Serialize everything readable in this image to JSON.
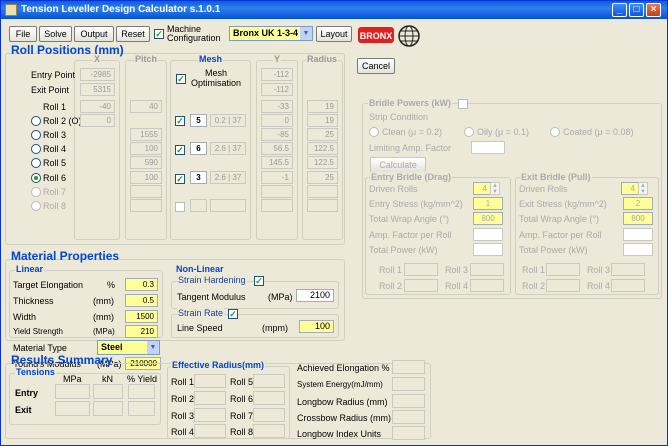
{
  "window": {
    "title": "Tension Leveller Design Calculator s.1.0.1"
  },
  "menu": {
    "file": "File",
    "solve": "Solve",
    "output": "Output",
    "reset": "Reset",
    "machine_config": "Machine Configuration",
    "config_value": "Bronx UK 1-3-4",
    "layout": "Layout",
    "cancel": "Cancel",
    "logo_text": "BRONX"
  },
  "rolls": {
    "title": "Roll Positions (mm)",
    "col_x": "X",
    "col_pitch": "Pitch",
    "col_mesh": "Mesh",
    "col_y": "Y",
    "col_radius": "Radius",
    "entry_point": "Entry Point",
    "exit_point": "Exit Point",
    "entry_x": "-2985",
    "exit_x": "5315",
    "entry_y": "-112",
    "exit_y": "-112",
    "mesh_opt": "Mesh Optimisation",
    "rows": [
      {
        "label": "Roll 1",
        "x": "-40",
        "pitch": "40",
        "mesh": "",
        "ratio": "",
        "y": "-33",
        "r": "19"
      },
      {
        "label": "Roll 2 (O)",
        "x": "0",
        "pitch": "",
        "mesh": "5",
        "ratio": "0.2 | 37",
        "y": "0",
        "r": "19"
      },
      {
        "label": "Roll 3",
        "x": "",
        "pitch": "1555",
        "mesh": "",
        "ratio": "",
        "y": "-85",
        "r": "25"
      },
      {
        "label": "Roll 4",
        "x": "",
        "pitch": "100",
        "mesh": "6",
        "ratio": "2.6 | 37",
        "y": "56.5",
        "r": "122.5"
      },
      {
        "label": "Roll 5",
        "x": "",
        "pitch": "590",
        "mesh": "",
        "ratio": "",
        "y": "145.5",
        "r": "122.5"
      },
      {
        "label": "Roll 6",
        "x": "",
        "pitch": "100",
        "mesh": "3",
        "ratio": "2.6 | 37",
        "y": "-1",
        "r": "25"
      },
      {
        "label": "Roll 7",
        "x": "",
        "pitch": "",
        "mesh": "",
        "ratio": "",
        "y": "",
        "r": ""
      },
      {
        "label": "Roll 8",
        "x": "",
        "pitch": "",
        "mesh": "",
        "ratio": "",
        "y": "",
        "r": ""
      }
    ]
  },
  "bridle": {
    "title": "Bridle Powers (kW)",
    "strip": "Strip Condition",
    "clean": "Clean (μ = 0.2)",
    "oily": "Oily (μ = 0.1)",
    "coated": "Coated (μ = 0.08)",
    "limiting": "Limiting Amp. Factor",
    "calculate": "Calculate",
    "entry_title": "Entry Bridle (Drag)",
    "exit_title": "Exit Bridle (Pull)",
    "driven": "Driven Rolls",
    "entry_stress": "Entry Stress (kg/mm^2)",
    "exit_stress": "Exit Stress (kg/mm^2)",
    "wrap": "Total Wrap Angle  (°)",
    "amp": "Amp. Factor per Roll",
    "power": "Total Power  (kW)",
    "entry_driven": "4",
    "entry_stress_val": "1",
    "entry_wrap": "800",
    "exit_driven": "4",
    "exit_stress_val": "2",
    "exit_wrap": "800",
    "r1": "Roll 1",
    "r2": "Roll 2",
    "r3": "Roll 3",
    "r4": "Roll 4"
  },
  "material": {
    "title": "Material Properties",
    "linear": "Linear",
    "nonlinear": "Non-Linear",
    "elong": "Target Elongation",
    "elong_u": "%",
    "elong_v": "0.3",
    "thick": "Thickness",
    "thick_u": "(mm)",
    "thick_v": "0.5",
    "width": "Width",
    "width_u": "(mm)",
    "width_v": "1500",
    "yield": "Yield Strength",
    "yield_u": "(MPa)",
    "yield_v": "210",
    "mtype": "Material Type",
    "mtype_v": "Steel",
    "young": "Young's Modulus",
    "young_u": "(MPa)",
    "young_v": "210000",
    "hard": "Strain Hardening",
    "tangent": "Tangent Modulus",
    "tangent_u": "(MPa)",
    "tangent_v": "2100",
    "rate": "Strain Rate",
    "speed": "Line Speed",
    "speed_u": "(mpm)",
    "speed_v": "100"
  },
  "results": {
    "title": "Results Summary",
    "tensions": "Tensions",
    "mpa": "MPa",
    "kn": "kN",
    "pyield": "% Yield",
    "entry": "Entry",
    "exit": "Exit",
    "eff": "Effective Radius(mm)",
    "rolls": [
      "Roll 1",
      "Roll 2",
      "Roll 3",
      "Roll 4",
      "Roll 5",
      "Roll 6",
      "Roll 7",
      "Roll 8"
    ],
    "achieved": "Achieved Elongation %",
    "energy": "System Energy(mJ/mm)",
    "longbow": "Longbow Radius  (mm)",
    "crossbow": "Crossbow Radius (mm)",
    "lbi": "Longbow Index Units"
  }
}
